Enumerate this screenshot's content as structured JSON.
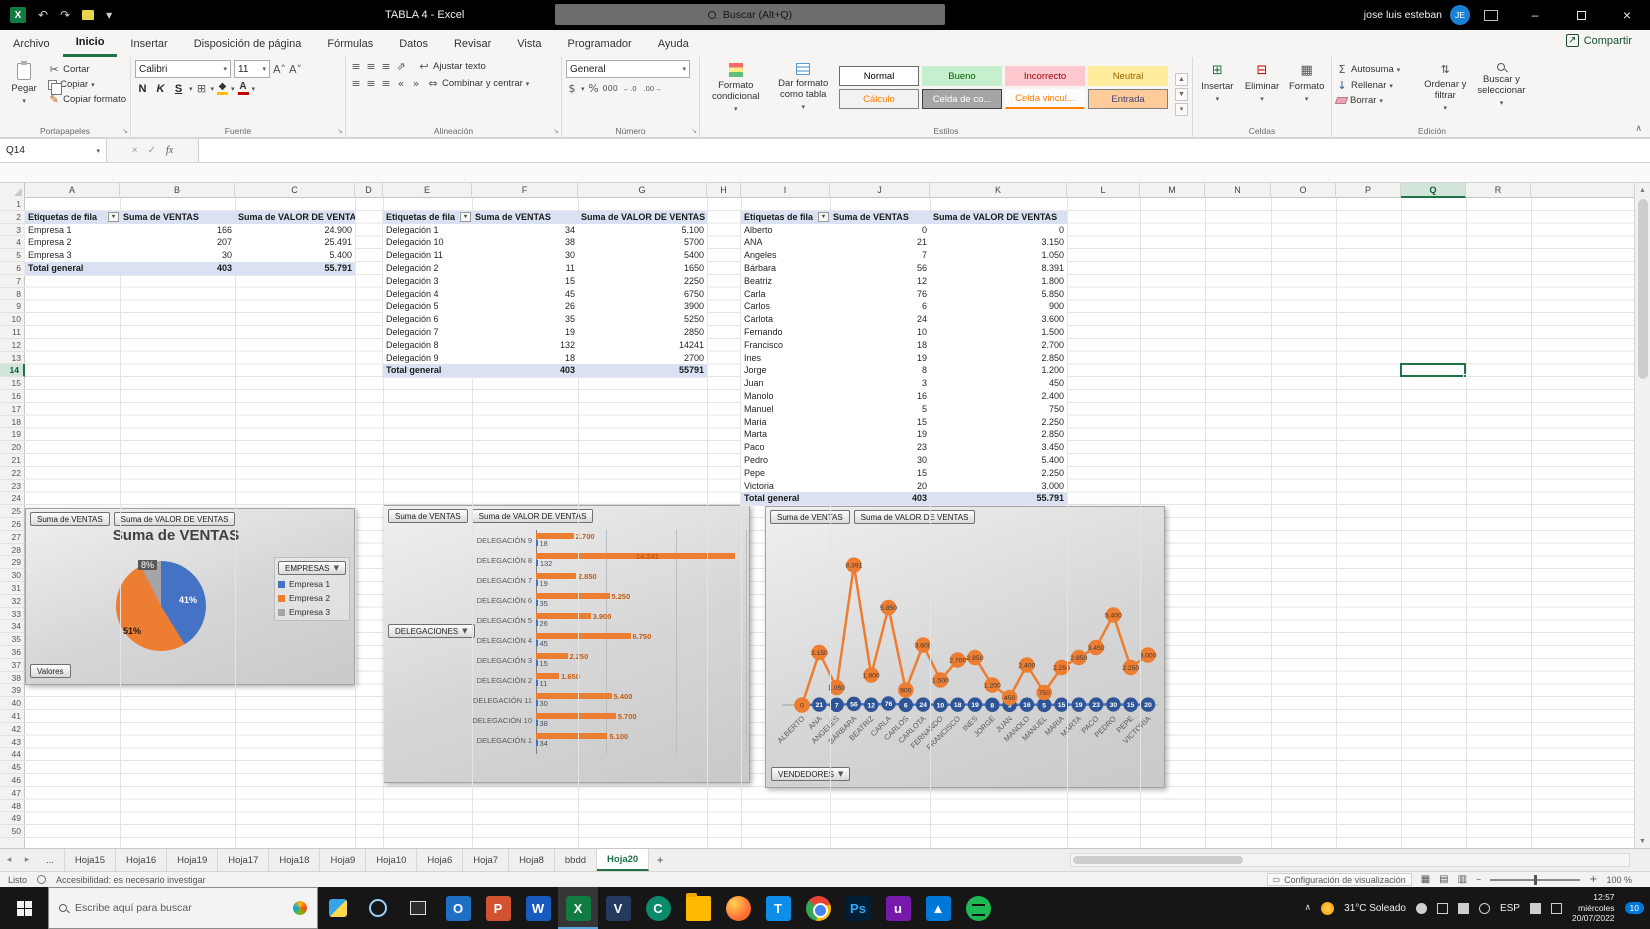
{
  "titlebar": {
    "title": "TABLA 4  -  Excel",
    "search_placeholder": "Buscar (Alt+Q)",
    "user_name": "jose luis esteban",
    "user_initials": "JE"
  },
  "icons": {
    "dropdown": "▾",
    "filter": "▼",
    "cut": "✂",
    "format_painter": "✎",
    "borders": "⊞",
    "wrap": "↩",
    "merge": "⇔",
    "orientation": "⇗",
    "align": "≡",
    "indent_left": "«",
    "indent_right": "»",
    "currency": "$",
    "percent": "%",
    "thousands": "000",
    "inc_decimal": "←.0",
    "dec_decimal": ".00→",
    "autosum": "Σ",
    "fill": "↓",
    "sort": "⇅",
    "share": "↗",
    "launcher": "↘",
    "collapse": "∧",
    "add_sheet": "+",
    "nav_left": "◂",
    "nav_right": "▸",
    "scroll_up": "▲",
    "scroll_down": "▼",
    "close": "×",
    "minimize": "–",
    "undo": "↶",
    "redo": "↷",
    "insert_cells": "⊞",
    "delete_cells": "⊟",
    "format_cells": "▦",
    "view_normal": "▦",
    "view_page": "▤",
    "view_break": "▥",
    "fx_cancel": "×",
    "fx_ok": "✓"
  },
  "ribbon": {
    "tabs": [
      "Archivo",
      "Inicio",
      "Insertar",
      "Disposición de página",
      "Fórmulas",
      "Datos",
      "Revisar",
      "Vista",
      "Programador",
      "Ayuda"
    ],
    "active_tab": "Inicio",
    "share_label": "Compartir",
    "portapapeles": {
      "label": "Portapapeles",
      "paste": "Pegar",
      "cut": "Cortar",
      "copy": "Copiar",
      "format_painter": "Copiar formato"
    },
    "fuente": {
      "label": "Fuente",
      "font_name": "Calibri",
      "font_size": "11",
      "bold": "N",
      "italic": "K",
      "underline": "S"
    },
    "alineacion": {
      "label": "Alineación",
      "wrap": "Ajustar texto",
      "merge": "Combinar y centrar"
    },
    "numero": {
      "label": "Número",
      "format": "General"
    },
    "estilos": {
      "label": "Estilos",
      "conditional": "Formato condicional",
      "format_table": "Dar formato como tabla",
      "styles": [
        {
          "name": "Normal"
        },
        {
          "name": "Bueno"
        },
        {
          "name": "Incorrecto"
        },
        {
          "name": "Neutral"
        },
        {
          "name": "Cálculo"
        },
        {
          "name": "Celda de co..."
        },
        {
          "name": "Celda vincul..."
        },
        {
          "name": "Entrada"
        }
      ]
    },
    "celdas": {
      "label": "Celdas",
      "insert": "Insertar",
      "delete": "Eliminar",
      "format": "Formato"
    },
    "edicion": {
      "label": "Edición",
      "autosum": "Autosuma",
      "fill": "Rellenar",
      "clear": "Borrar",
      "sort": "Ordenar y filtrar",
      "find": "Buscar y seleccionar"
    }
  },
  "formula_bar": {
    "name_box": "Q14",
    "fx": "fx"
  },
  "grid": {
    "columns": [
      "A",
      "B",
      "C",
      "D",
      "E",
      "F",
      "G",
      "H",
      "I",
      "J",
      "K",
      "L",
      "M",
      "N",
      "O",
      "P",
      "Q",
      "R"
    ],
    "selected_col": "Q",
    "selected_row": 14,
    "row_count": 50
  },
  "pivot_empresas": {
    "headers": [
      "Etiquetas de fila",
      "Suma de VENTAS",
      "Suma de VALOR DE VENTAS"
    ],
    "rows": [
      [
        "Empresa 1",
        "166",
        "24.900"
      ],
      [
        "Empresa 2",
        "207",
        "25.491"
      ],
      [
        "Empresa 3",
        "30",
        "5.400"
      ]
    ],
    "total": [
      "Total general",
      "403",
      "55.791"
    ]
  },
  "pivot_delegaciones": {
    "headers": [
      "Etiquetas de fila",
      "Suma de VENTAS",
      "Suma de VALOR DE VENTAS"
    ],
    "rows": [
      [
        "Delegación 1",
        "34",
        "5.100"
      ],
      [
        "Delegación 10",
        "38",
        "5700"
      ],
      [
        "Delegación 11",
        "30",
        "5400"
      ],
      [
        "Delegación 2",
        "11",
        "1650"
      ],
      [
        "Delegación 3",
        "15",
        "2250"
      ],
      [
        "Delegación 4",
        "45",
        "6750"
      ],
      [
        "Delegación 5",
        "26",
        "3900"
      ],
      [
        "Delegación 6",
        "35",
        "5250"
      ],
      [
        "Delegación 7",
        "19",
        "2850"
      ],
      [
        "Delegación 8",
        "132",
        "14241"
      ],
      [
        "Delegación 9",
        "18",
        "2700"
      ]
    ],
    "total": [
      "Total general",
      "403",
      "55791"
    ]
  },
  "pivot_vendedores": {
    "headers": [
      "Etiquetas de fila",
      "Suma de VENTAS",
      "Suma de VALOR DE VENTAS"
    ],
    "rows": [
      [
        "Alberto",
        "0",
        "0"
      ],
      [
        "ANA",
        "21",
        "3.150"
      ],
      [
        "Angeles",
        "7",
        "1.050"
      ],
      [
        "Bárbara",
        "56",
        "8.391"
      ],
      [
        "Beatriz",
        "12",
        "1.800"
      ],
      [
        "Carla",
        "76",
        "5.850"
      ],
      [
        "Carlos",
        "6",
        "900"
      ],
      [
        "Carlota",
        "24",
        "3.600"
      ],
      [
        "Fernando",
        "10",
        "1.500"
      ],
      [
        "Francisco",
        "18",
        "2.700"
      ],
      [
        "Ines",
        "19",
        "2.850"
      ],
      [
        "Jorge",
        "8",
        "1.200"
      ],
      [
        "Juan",
        "3",
        "450"
      ],
      [
        "Manolo",
        "16",
        "2.400"
      ],
      [
        "Manuel",
        "5",
        "750"
      ],
      [
        "Maria",
        "15",
        "2.250"
      ],
      [
        "Marta",
        "19",
        "2.850"
      ],
      [
        "Paco",
        "23",
        "3.450"
      ],
      [
        "Pedro",
        "30",
        "5.400"
      ],
      [
        "Pepe",
        "15",
        "2.250"
      ],
      [
        "Victoria",
        "20",
        "3.000"
      ]
    ],
    "total": [
      "Total general",
      "403",
      "55.791"
    ]
  },
  "chart_data": [
    {
      "type": "pie",
      "title": "Suma de VENTAS",
      "field_buttons": [
        "Suma de VENTAS",
        "Suma de VALOR DE VENTAS"
      ],
      "legend_title": "EMPRESAS",
      "axis_button": "Valores",
      "categories": [
        "Empresa 1",
        "Empresa 2",
        "Empresa 3"
      ],
      "values": [
        166,
        207,
        30
      ],
      "percent_labels": [
        "41%",
        "51%",
        "8%"
      ],
      "colors": [
        "#4472C4",
        "#ED7D31",
        "#A5A5A5"
      ]
    },
    {
      "type": "bar",
      "field_buttons": [
        "Suma de VENTAS",
        "Suma de VALOR DE VENTAS"
      ],
      "axis_button": "DELEGACIONES",
      "categories": [
        "DELEGACIÓN 9",
        "DELEGACIÓN 8",
        "DELEGACIÓN 7",
        "DELEGACIÓN 6",
        "DELEGACIÓN 5",
        "DELEGACIÓN 4",
        "DELEGACIÓN 3",
        "DELEGACIÓN 2",
        "DELEGACIÓN 11",
        "DELEGACIÓN 10",
        "DELEGACIÓN 1"
      ],
      "series": [
        {
          "name": "Suma de VENTAS",
          "color": "#4472C4",
          "values": [
            18,
            132,
            19,
            35,
            26,
            45,
            15,
            11,
            30,
            38,
            34
          ],
          "labels": [
            "18",
            "132",
            "19",
            "35",
            "26",
            "45",
            "15",
            "11",
            "30",
            "38",
            "34"
          ]
        },
        {
          "name": "Suma de VALOR DE VENTAS",
          "color": "#ED7D31",
          "values": [
            2700,
            14241,
            2850,
            5250,
            3900,
            6750,
            2250,
            1650,
            5400,
            5700,
            5100
          ],
          "labels": [
            "2.700",
            "14.241",
            "2.850",
            "5.250",
            "3.900",
            "6.750",
            "2.250",
            "1.650",
            "5.400",
            "5.700",
            "5.100"
          ]
        }
      ],
      "xlim": [
        0,
        15000
      ]
    },
    {
      "type": "line",
      "field_buttons": [
        "Suma de VENTAS",
        "Suma de VALOR DE VENTAS"
      ],
      "axis_button": "VENDEDORES",
      "categories": [
        "ALBERTO",
        "ANA",
        "ANGELES",
        "BÁRBARA",
        "BEATRIZ",
        "CARLA",
        "CARLOS",
        "CARLOTA",
        "FERNANDO",
        "FRANCISCO",
        "INES",
        "JORGE",
        "JUAN",
        "MANOLO",
        "MANUEL",
        "MARIA",
        "MARTA",
        "PACO",
        "PEDRO",
        "PEPE",
        "VICTORIA"
      ],
      "series": [
        {
          "name": "Suma de VENTAS",
          "color": "#2F5597",
          "values": [
            0,
            21,
            7,
            56,
            12,
            76,
            6,
            24,
            10,
            18,
            19,
            8,
            3,
            16,
            5,
            15,
            19,
            23,
            30,
            15,
            20
          ],
          "labels": [
            "0",
            "21",
            "7",
            "56",
            "12",
            "76",
            "6",
            "24",
            "10",
            "18",
            "19",
            "8",
            "3",
            "16",
            "5",
            "15",
            "19",
            "23",
            "30",
            "15",
            "20"
          ]
        },
        {
          "name": "Suma de VALOR DE VENTAS",
          "color": "#ED7D31",
          "values": [
            0,
            3150,
            1050,
            8391,
            1800,
            5850,
            900,
            3600,
            1500,
            2700,
            2850,
            1200,
            450,
            2400,
            750,
            2250,
            2850,
            3450,
            5400,
            2250,
            3000
          ],
          "labels": [
            "0",
            "3.150",
            "1.050",
            "8.391",
            "1.800",
            "5.850",
            "900",
            "3.600",
            "1.500",
            "2.700",
            "2.850",
            "1.200",
            "450",
            "2.400",
            "750",
            "2.250",
            "2.850",
            "3.450",
            "5.400",
            "2.250",
            "3.000"
          ]
        }
      ],
      "ylim": [
        0,
        9000
      ]
    }
  ],
  "sheet_tabs": {
    "overflow": "...",
    "tabs": [
      "Hoja15",
      "Hoja16",
      "Hoja19",
      "Hoja17",
      "Hoja18",
      "Hoja9",
      "Hoja10",
      "Hoja6",
      "Hoja7",
      "Hoja8",
      "bbdd",
      "Hoja20"
    ],
    "active": "Hoja20",
    "add": "+"
  },
  "status_bar": {
    "ready": "Listo",
    "accessibility": "Accesibilidad: es necesario investigar",
    "display_settings": "Configuración de visualización",
    "zoom": "100 %"
  },
  "taskbar": {
    "search_placeholder": "Escribe aquí para buscar",
    "apps": [
      {
        "name": "outlook",
        "label": "O",
        "color": "#1f6fc5"
      },
      {
        "name": "powerpoint",
        "label": "P",
        "color": "#d35230"
      },
      {
        "name": "word",
        "label": "W",
        "color": "#185abd"
      },
      {
        "name": "excel",
        "label": "X",
        "color": "#107c41",
        "active": true
      },
      {
        "name": "app-v",
        "label": "V",
        "color": "#243a5e"
      },
      {
        "name": "app-c",
        "label": "C",
        "color": "#0c8a6a",
        "round": true
      },
      {
        "name": "explorer",
        "label": "",
        "cls": "folder"
      },
      {
        "name": "firefox",
        "label": "",
        "cls": "firefox"
      },
      {
        "name": "teamviewer",
        "label": "T",
        "color": "#0e8ee9"
      },
      {
        "name": "chrome",
        "label": "",
        "cls": "chrome"
      },
      {
        "name": "photoshop",
        "label": "Ps",
        "color": "#001e36",
        "fg": "#31a8ff"
      },
      {
        "name": "app-u",
        "label": "u",
        "color": "#7719aa"
      },
      {
        "name": "photos",
        "label": "▲",
        "color": "#0078d7"
      },
      {
        "name": "spotify",
        "label": "",
        "cls": "spotify"
      }
    ],
    "tray": {
      "weather": "31°C Soleado",
      "lang": "ESP",
      "time": "12:57",
      "day": "miércoles",
      "date": "20/07/2022",
      "notifications": "10"
    }
  }
}
